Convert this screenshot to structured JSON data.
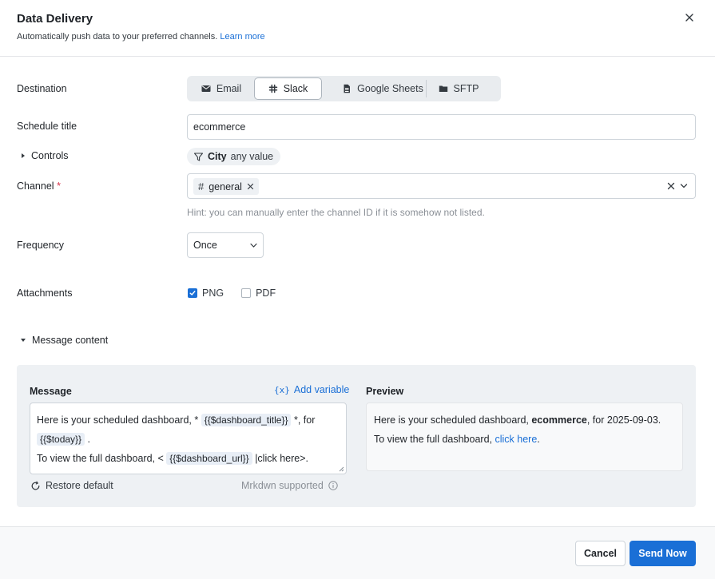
{
  "header": {
    "title": "Data Delivery",
    "subtitle": "Automatically push data to your preferred channels.",
    "learn_more": "Learn more"
  },
  "destination": {
    "label": "Destination",
    "options": [
      "Email",
      "Slack",
      "Google Sheets",
      "SFTP"
    ],
    "selected": "Slack"
  },
  "schedule_title": {
    "label": "Schedule title",
    "value": "ecommerce"
  },
  "controls": {
    "label": "Controls",
    "filter_name": "City",
    "filter_value": "any value"
  },
  "channel": {
    "label": "Channel",
    "required_mark": "*",
    "selected_chip": "general",
    "hint": "Hint: you can manually enter the channel ID if it is somehow not listed."
  },
  "frequency": {
    "label": "Frequency",
    "value": "Once"
  },
  "attachments": {
    "label": "Attachments",
    "png": {
      "label": "PNG",
      "checked": true
    },
    "pdf": {
      "label": "PDF",
      "checked": false
    }
  },
  "message_content": {
    "label": "Message content",
    "message_label": "Message",
    "add_variable": "Add variable",
    "template": {
      "t1": "Here is your scheduled dashboard, *",
      "v1": "{{$dashboard_title}}",
      "t2": "*, for",
      "v2": "{{$today}}",
      "t3": ".",
      "t4": "To view the full dashboard, <",
      "v3": "{{$dashboard_url}}",
      "t5": "|click here>."
    },
    "restore_default": "Restore default",
    "mrkdwn": "Mrkdwn supported",
    "preview_label": "Preview",
    "preview": {
      "p1": "Here is your scheduled dashboard,",
      "p1_bold": "ecommerce",
      "p1_end": ", for 2025-09-03.",
      "p2": "To view the full dashboard,",
      "p2_link": "click here",
      "p2_end": "."
    }
  },
  "footer": {
    "cancel": "Cancel",
    "send_now": "Send Now"
  },
  "colors": {
    "accent": "#1a6fd6",
    "required": "#d6334a"
  }
}
